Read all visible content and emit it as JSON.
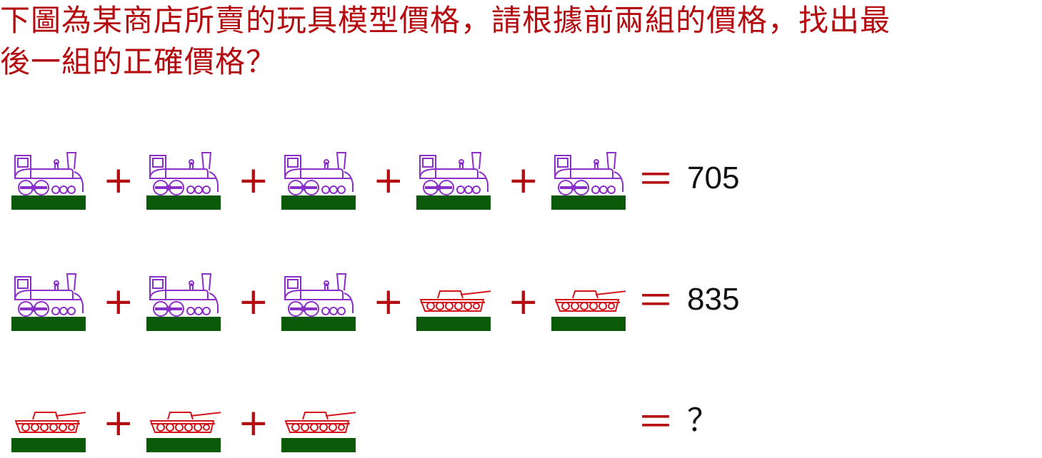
{
  "question": {
    "line1": "下圖為某商店所賣的玩具模型價格，請根據前兩組的價格，找出最",
    "line2": "後一組的正確價格？"
  },
  "colors": {
    "text": "#b40b10",
    "train": "#8b2fc9",
    "tank": "#d4151a",
    "ground": "#0a5a0a"
  },
  "icons": {
    "train": "train-icon",
    "tank": "tank-icon"
  },
  "symbols": {
    "plus": "+",
    "equals": "＝"
  },
  "equations": [
    {
      "items": [
        "train",
        "train",
        "train",
        "train",
        "train"
      ],
      "result": "705"
    },
    {
      "items": [
        "train",
        "train",
        "train",
        "tank",
        "tank"
      ],
      "result": "835"
    },
    {
      "items": [
        "tank",
        "tank",
        "tank"
      ],
      "result": "？"
    }
  ]
}
